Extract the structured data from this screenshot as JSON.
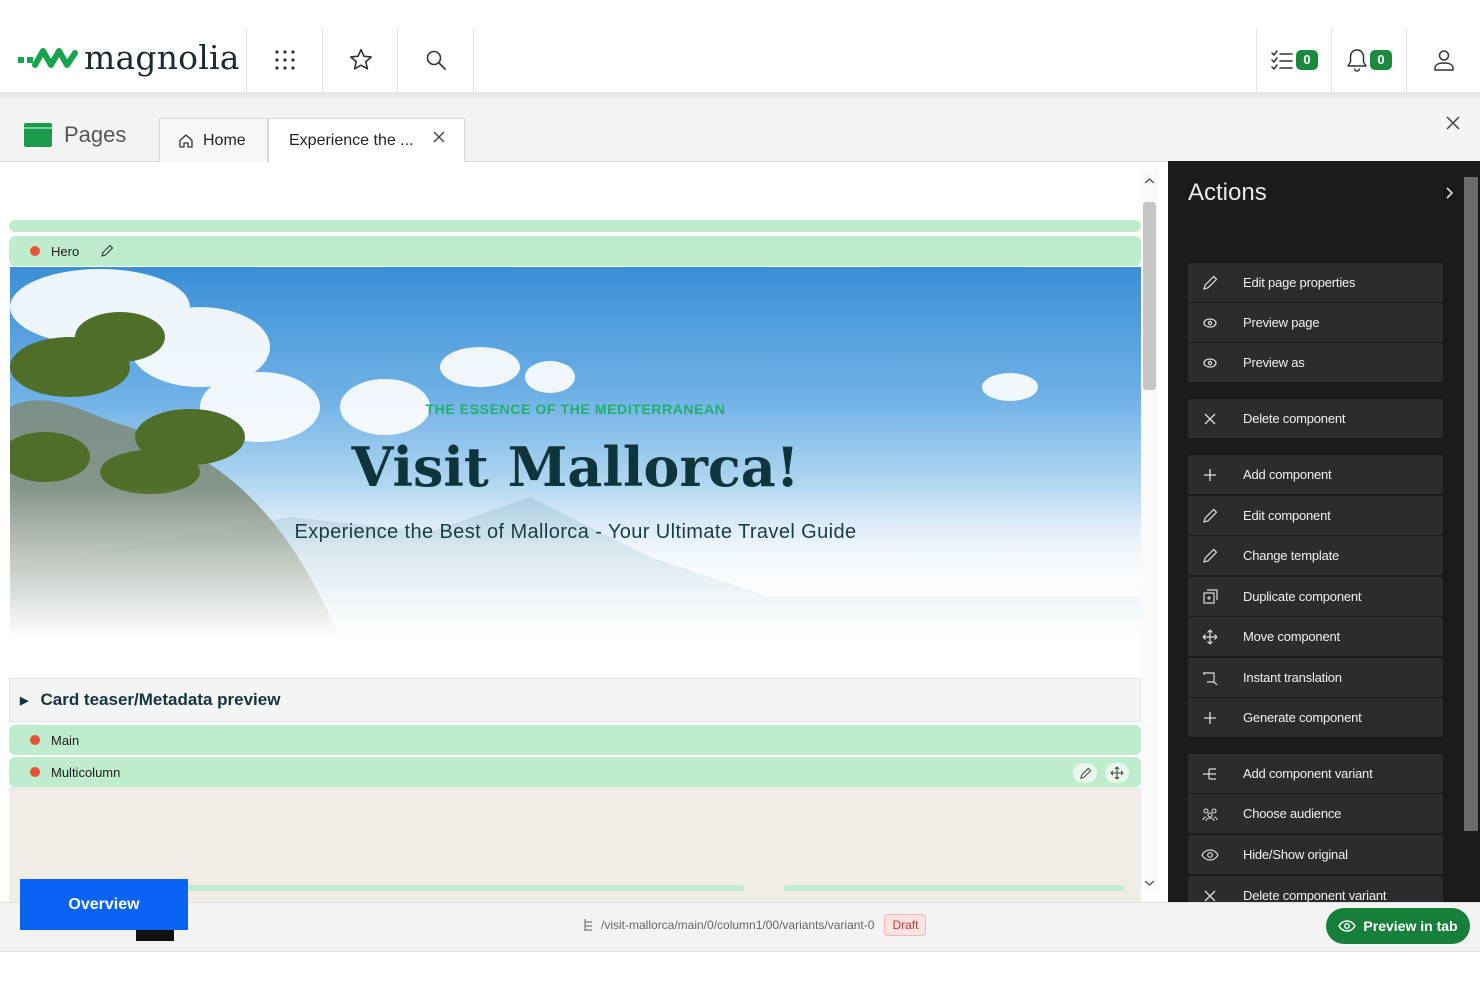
{
  "topbar": {
    "logo_text": "magnolia",
    "tasks_count": "0",
    "notifications_count": "0"
  },
  "app": {
    "title": "Pages",
    "tabs": [
      {
        "label": "Home"
      },
      {
        "label": "Experience the ..."
      }
    ]
  },
  "editor": {
    "hero_bar_label": "Hero",
    "hero": {
      "eyebrow": "THE ESSENCE OF THE MEDITERRANEAN",
      "title": "Visit Mallorca!",
      "subtitle": "Experience the Best of Mallorca - Your Ultimate Travel Guide"
    },
    "card_teaser_label": "Card teaser/Metadata preview",
    "main_bar_label": "Main",
    "multicolumn_bar_label": "Multicolumn"
  },
  "actions": {
    "title": "Actions",
    "items": [
      {
        "label": "Edit page properties",
        "icon": "pencil-icon"
      },
      {
        "label": "Preview page",
        "icon": "preview-icon"
      },
      {
        "label": "Preview as",
        "icon": "preview-icon"
      },
      {
        "label": "Delete component",
        "icon": "close-icon"
      },
      {
        "label": "Add component",
        "icon": "plus-icon"
      },
      {
        "label": "Edit component",
        "icon": "pencil-icon"
      },
      {
        "label": "Change template",
        "icon": "pencil-icon"
      },
      {
        "label": "Duplicate component",
        "icon": "duplicate-icon"
      },
      {
        "label": "Move component",
        "icon": "move-icon"
      },
      {
        "label": "Instant translation",
        "icon": "translate-icon"
      },
      {
        "label": "Generate component",
        "icon": "plus-icon"
      },
      {
        "label": "Add component variant",
        "icon": "variant-icon"
      },
      {
        "label": "Choose audience",
        "icon": "audience-icon"
      },
      {
        "label": "Hide/Show original",
        "icon": "eye-icon"
      },
      {
        "label": "Delete component variant",
        "icon": "close-icon"
      }
    ]
  },
  "footer": {
    "path": "/visit-mallorca/main/0/column1/00/variants/variant-0",
    "status": "Draft",
    "preview_tab_label": "Preview in tab",
    "overview_label": "Overview"
  },
  "colors": {
    "accent_green": "#1b8a3f",
    "component_bar": "#bfeccc",
    "overview_blue": "#0a63f2",
    "panel_dark": "#1b1b1c"
  }
}
